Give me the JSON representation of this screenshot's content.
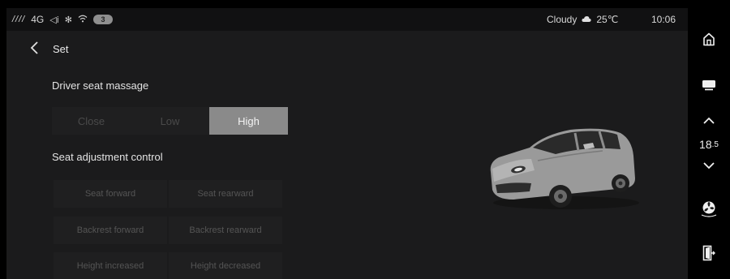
{
  "status": {
    "signal": "////",
    "network": "4G",
    "badge": "3",
    "weather": "Cloudy",
    "temperature": "25℃",
    "time": "10:06"
  },
  "header": {
    "title": "Set"
  },
  "massage": {
    "label": "Driver seat massage",
    "options": [
      "Close",
      "Low",
      "High"
    ],
    "selected": "High"
  },
  "adjust": {
    "label": "Seat adjustment control",
    "buttons": [
      "Seat forward",
      "Seat rearward",
      "Backrest forward",
      "Backrest rearward",
      "Height increased",
      "Height decreased"
    ]
  },
  "rail": {
    "temp_main": "18",
    "temp_decimal": ".5"
  },
  "colors": {
    "active_segment": "#8a8a8a",
    "background": "#1b1b1c"
  }
}
